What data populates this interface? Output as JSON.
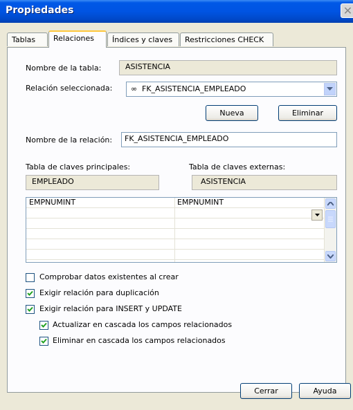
{
  "window": {
    "title": "Propiedades"
  },
  "tabs": [
    {
      "label": "Tablas"
    },
    {
      "label": "Relaciones"
    },
    {
      "label": "Índices y claves"
    },
    {
      "label": "Restricciones CHECK"
    }
  ],
  "form": {
    "table_name_label": "Nombre de la tabla:",
    "table_name_value": "ASISTENCIA",
    "selected_relation_label": "Relación seleccionada:",
    "selected_relation_value": "FK_ASISTENCIA_EMPLEADO",
    "relation_icon": "∞",
    "new_button": "Nueva",
    "delete_button": "Eliminar",
    "relation_name_label": "Nombre de la relación:",
    "relation_name_value": "FK_ASISTENCIA_EMPLEADO",
    "primary_table_label": "Tabla de claves principales:",
    "primary_table_value": "EMPLEADO",
    "foreign_table_label": "Tabla de claves externas:",
    "foreign_table_value": "ASISTENCIA"
  },
  "key_grid": {
    "rows": [
      {
        "primary": "EMPNUMINT",
        "foreign": "EMPNUMINT"
      },
      {
        "primary": "",
        "foreign": ""
      },
      {
        "primary": "",
        "foreign": ""
      },
      {
        "primary": "",
        "foreign": ""
      },
      {
        "primary": "",
        "foreign": ""
      },
      {
        "primary": "",
        "foreign": ""
      }
    ]
  },
  "options": [
    {
      "label": "Comprobar datos existentes al crear",
      "checked": false
    },
    {
      "label": "Exigir relación para duplicación",
      "checked": true
    },
    {
      "label": "Exigir relación para INSERT y UPDATE",
      "checked": true
    },
    {
      "label": "Actualizar en cascada los campos relacionados",
      "checked": true
    },
    {
      "label": "Eliminar en cascada los campos relacionados",
      "checked": true
    }
  ],
  "footer": {
    "close_button": "Cerrar",
    "help_button": "Ayuda"
  }
}
